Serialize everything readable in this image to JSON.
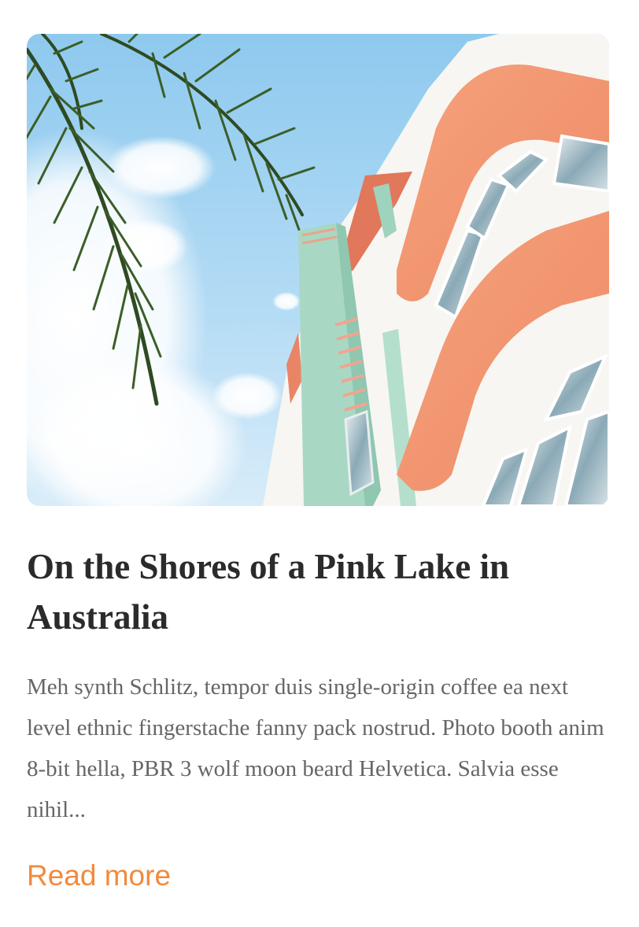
{
  "article": {
    "image_alt": "Pastel art deco building with palm fronds against a blue sky",
    "title": "On the Shores of a Pink Lake in Australia",
    "excerpt": "Meh synth Schlitz, tempor duis single-origin coffee ea next level ethnic fingerstache fanny pack nostrud. Photo booth anim 8-bit hella, PBR 3 wolf moon beard Helvetica. Salvia esse nihil...",
    "read_more_label": "Read more"
  },
  "colors": {
    "title": "#2b2b2b",
    "excerpt": "#666666",
    "accent": "#f28a3c"
  }
}
